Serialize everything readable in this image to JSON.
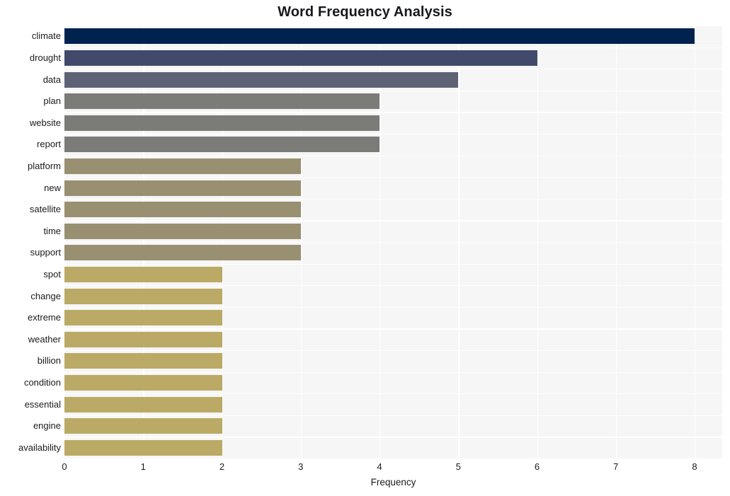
{
  "chart_data": {
    "type": "bar",
    "orientation": "horizontal",
    "title": "Word Frequency Analysis",
    "xlabel": "Frequency",
    "ylabel": "",
    "xlim": [
      0,
      8.35
    ],
    "ylim": [
      0,
      20
    ],
    "grid": true,
    "legend": null,
    "xticks": [
      0,
      1,
      2,
      3,
      4,
      5,
      6,
      7,
      8
    ],
    "categories": [
      "climate",
      "drought",
      "data",
      "plan",
      "website",
      "report",
      "platform",
      "new",
      "satellite",
      "time",
      "support",
      "spot",
      "change",
      "extreme",
      "weather",
      "billion",
      "condition",
      "essential",
      "engine",
      "availability"
    ],
    "values": [
      8,
      6,
      5,
      4,
      4,
      4,
      3,
      3,
      3,
      3,
      3,
      2,
      2,
      2,
      2,
      2,
      2,
      2,
      2,
      2
    ],
    "bar_colors": [
      "#00224e",
      "#414a6b",
      "#5d6374",
      "#7b7b78",
      "#7b7b78",
      "#7b7b78",
      "#989070",
      "#989070",
      "#989070",
      "#989070",
      "#989070",
      "#bbaa66",
      "#bbaa66",
      "#bbaa66",
      "#bbaa66",
      "#bbaa66",
      "#bbaa66",
      "#bbaa66",
      "#bbaa66",
      "#bbaa66"
    ],
    "plot_background": "#f6f6f6",
    "grid_color": "#ffffff",
    "figure_background": "#ffffff",
    "text_color": "#1b1b1b"
  }
}
